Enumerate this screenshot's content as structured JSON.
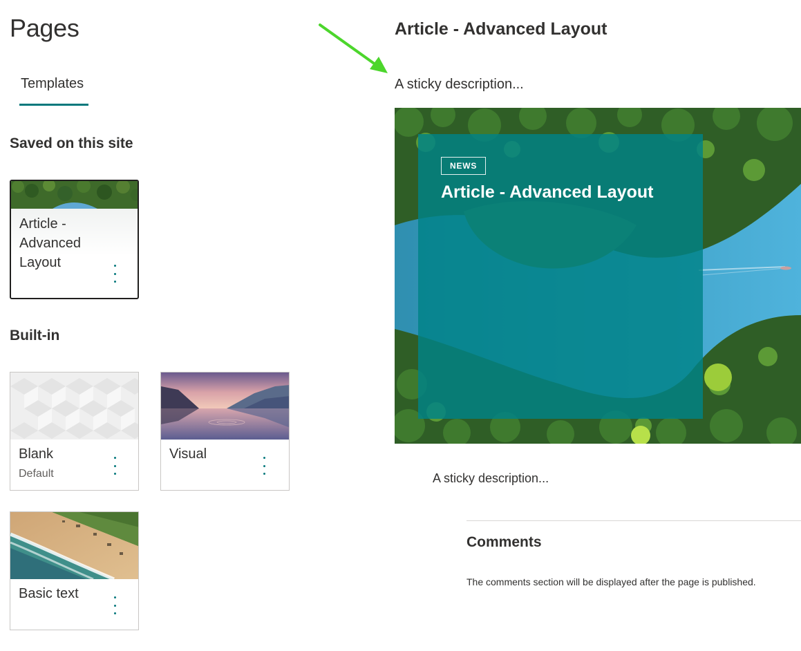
{
  "page": {
    "title": "Pages"
  },
  "tabs": [
    {
      "label": "Templates"
    }
  ],
  "sections": {
    "saved": "Saved on this site",
    "builtin": "Built-in"
  },
  "saved_templates": [
    {
      "title_lines": [
        "Article -",
        "Advanced",
        "Layout"
      ]
    }
  ],
  "builtin_templates": [
    {
      "title": "Blank",
      "subtitle": "Default"
    },
    {
      "title": "Visual"
    },
    {
      "title": "Basic text"
    }
  ],
  "preview": {
    "title": "Article - Advanced Layout",
    "description": "A sticky description...",
    "hero": {
      "badge": "NEWS",
      "title": "Article - Advanced Layout"
    },
    "body_description": "A sticky description...",
    "comments": {
      "title": "Comments",
      "note": "The comments section will be displayed after the page is published."
    }
  },
  "colors": {
    "accent": "#03787c",
    "hero_panel": "#008287",
    "annotation_arrow": "#4cd62c"
  },
  "icons": [
    "more-vertical-icon",
    "annotation-arrow-icon"
  ]
}
